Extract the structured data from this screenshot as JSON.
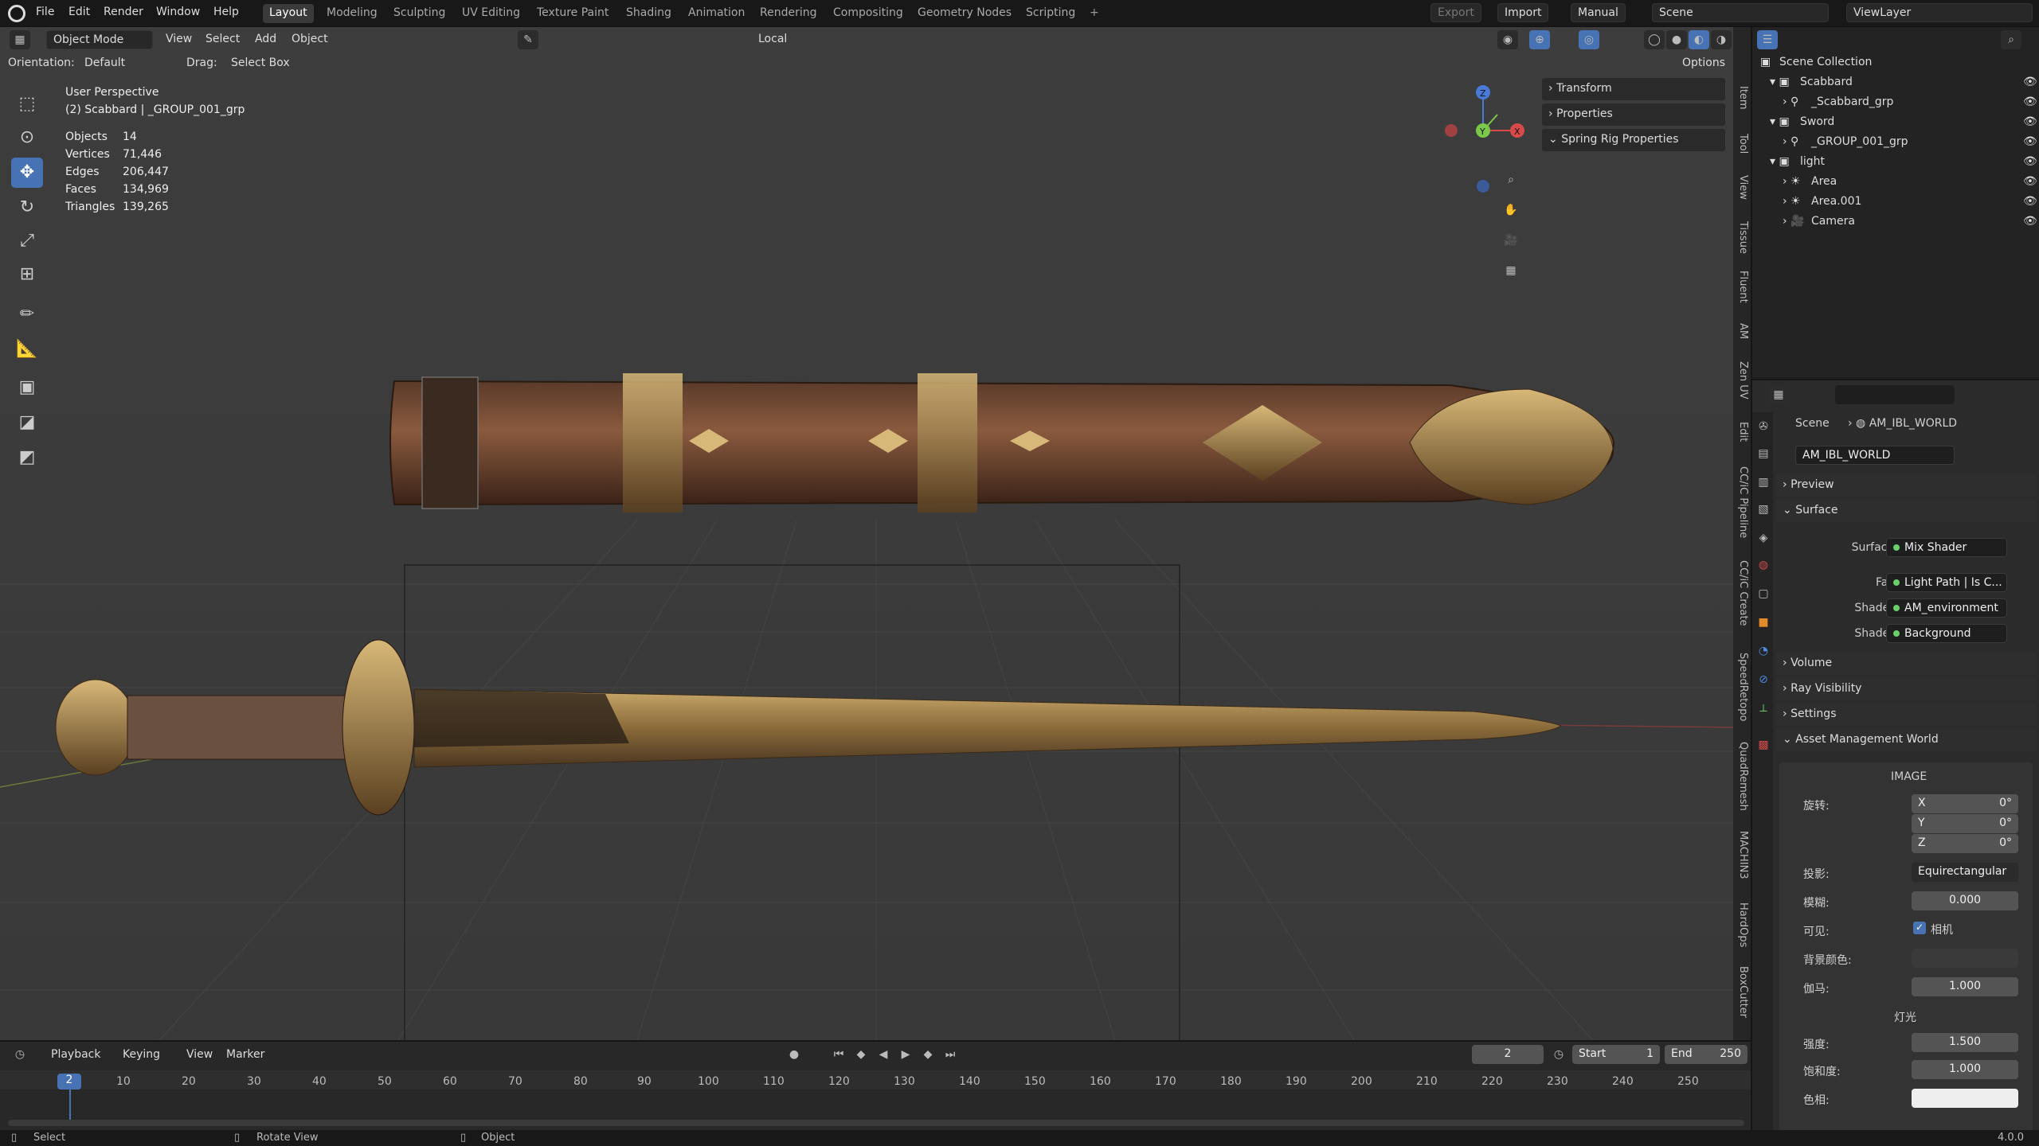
{
  "menubar": {
    "items": [
      "File",
      "Edit",
      "Render",
      "Window",
      "Help"
    ]
  },
  "workspaces": [
    "Layout",
    "Modeling",
    "Sculpting",
    "UV Editing",
    "Texture Paint",
    "Shading",
    "Animation",
    "Rendering",
    "Compositing",
    "Geometry Nodes",
    "Scripting"
  ],
  "topright": {
    "export": "Export",
    "import": "Import",
    "manual": "Manual",
    "scene": "Scene",
    "viewlayer": "ViewLayer"
  },
  "viewport_header": {
    "mode": "Object Mode",
    "menus": [
      "View",
      "Select",
      "Add",
      "Object"
    ],
    "pivot": "Local",
    "options": "Options"
  },
  "viewport_header2": {
    "orientation_label": "Orientation:",
    "orientation": "Default",
    "drag_label": "Drag:",
    "drag": "Select Box"
  },
  "overlay": {
    "perspective": "User Perspective",
    "object": "(2) Scabbard | _GROUP_001_grp",
    "stats": [
      {
        "k": "Objects",
        "v": "14"
      },
      {
        "k": "Vertices",
        "v": "71,446"
      },
      {
        "k": "Edges",
        "v": "206,447"
      },
      {
        "k": "Faces",
        "v": "134,969"
      },
      {
        "k": "Triangles",
        "v": "139,265"
      }
    ]
  },
  "gizmo": {
    "x": "X",
    "y": "Y",
    "z": "Z"
  },
  "npanel": {
    "rows": [
      "Transform",
      "Properties",
      "Spring Rig Properties"
    ]
  },
  "vtabs": [
    "Item",
    "Tool",
    "View",
    "Tissue",
    "Fluent",
    "AM",
    "Zen UV",
    "Edit",
    "CC/iC Pipeline",
    "CC/iC Create",
    "SpeedRetopo",
    "QuadRemesh",
    "MACHIN3",
    "HardOps",
    "BoxCutter"
  ],
  "outliner": {
    "title": "Scene Collection",
    "rows": [
      {
        "label": "Scabbard",
        "indent": 1
      },
      {
        "label": "_Scabbard_grp",
        "indent": 2
      },
      {
        "label": "Sword",
        "indent": 1
      },
      {
        "label": "_GROUP_001_grp",
        "indent": 2
      },
      {
        "label": "light",
        "indent": 1
      },
      {
        "label": "Area",
        "indent": 2
      },
      {
        "label": "Area.001",
        "indent": 2
      },
      {
        "label": "Camera",
        "indent": 2
      }
    ]
  },
  "properties": {
    "breadcrumb_scene": "Scene",
    "breadcrumb_world": "AM_IBL_WORLD",
    "world_name": "AM_IBL_WORLD",
    "preview": "Preview",
    "surface_hdr": "Surface",
    "surface_lbl": "Surface",
    "surface_val": "Mix Shader",
    "fac_lbl": "Fac",
    "fac_val": "Light Path | Is C...",
    "shader1_lbl": "Shader",
    "shader1_val": "AM_environment",
    "shader2_lbl": "Shader",
    "shader2_val": "Background",
    "volume": "Volume",
    "ray": "Ray Visibility",
    "settings": "Settings",
    "amw": "Asset Management World",
    "image_hdr": "IMAGE",
    "rot_lbl": "旋转:",
    "rx": "X",
    "rxv": "0°",
    "ry": "Y",
    "ryv": "0°",
    "rz": "Z",
    "rzv": "0°",
    "proj_lbl": "投影:",
    "proj_val": "Equirectangular",
    "blur_lbl": "模糊:",
    "blur_val": "0.000",
    "vis_lbl": "可见:",
    "vis_val": "相机",
    "bg_lbl": "背景颜色:",
    "gamma_lbl": "伽马:",
    "gamma_val": "1.000",
    "light_hdr": "灯光",
    "str_lbl": "强度:",
    "str_val": "1.500",
    "sat_lbl": "饱和度:",
    "sat_val": "1.000",
    "hue_lbl": "色相:"
  },
  "timeline": {
    "menus": [
      "Playback",
      "Keying",
      "View",
      "Marker"
    ],
    "current": "2",
    "start_lbl": "Start",
    "start": "1",
    "end_lbl": "End",
    "end": "250",
    "frames": [
      "2",
      "10",
      "20",
      "30",
      "40",
      "50",
      "60",
      "70",
      "80",
      "90",
      "100",
      "110",
      "120",
      "130",
      "140",
      "150",
      "160",
      "170",
      "180",
      "190",
      "200",
      "210",
      "220",
      "230",
      "240",
      "250"
    ]
  },
  "status": {
    "select": "Select",
    "rotate": "Rotate View",
    "object": "Object",
    "version": "4.0.0"
  }
}
